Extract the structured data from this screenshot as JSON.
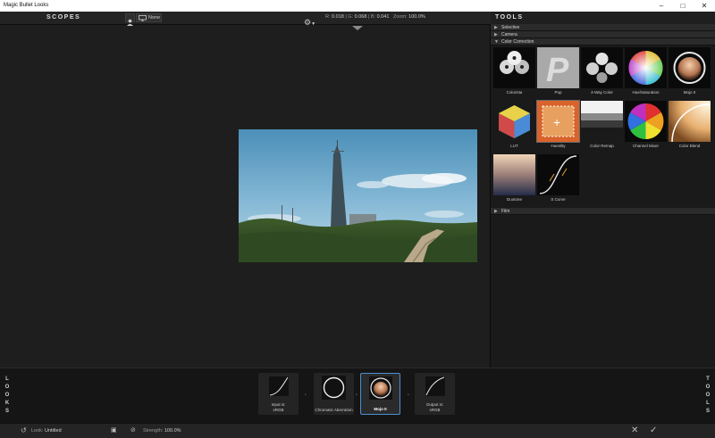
{
  "window": {
    "title": "Magic Bullet Looks"
  },
  "topbar": {
    "scopes_label": "SCOPES",
    "none_label": "None",
    "readout": {
      "r_label": "R:",
      "r": "0.018",
      "g_label": "G:",
      "g": "0.068",
      "b_label": "B:",
      "b": "0.041",
      "zoom_label": "Zoom:",
      "zoom": "100.0%"
    }
  },
  "tools": {
    "title": "TOOLS",
    "categories": [
      {
        "label": "Selective",
        "expanded": false
      },
      {
        "label": "Camera",
        "expanded": false
      },
      {
        "label": "Color Correction",
        "expanded": true
      },
      {
        "label": "Film",
        "expanded": false
      }
    ],
    "items": [
      {
        "label": "Colorista",
        "icon": "colorista-wheels-icon"
      },
      {
        "label": "Pop",
        "icon": "pop-p-icon"
      },
      {
        "label": "4-Way Color",
        "icon": "four-way-color-icon"
      },
      {
        "label": "Hue/Saturation",
        "icon": "hue-saturation-wheel-icon"
      },
      {
        "label": "Mojo II",
        "icon": "mojo-orb-icon"
      },
      {
        "label": "LUT",
        "icon": "lut-cube-icon"
      },
      {
        "label": "Hueslity",
        "icon": "hueslity-icon"
      },
      {
        "label": "Color Remap",
        "icon": "color-remap-icon"
      },
      {
        "label": "Channel Mixer",
        "icon": "channel-mixer-icon"
      },
      {
        "label": "Color Blend",
        "icon": "color-blend-icon"
      },
      {
        "label": "Duotone",
        "icon": "duotone-gradient-icon"
      },
      {
        "label": "S Curve",
        "icon": "s-curve-icon"
      }
    ]
  },
  "chain": {
    "left_label": [
      "L",
      "O",
      "O",
      "K",
      "S"
    ],
    "right_label": [
      "T",
      "O",
      "O",
      "L",
      "S"
    ],
    "nodes": [
      {
        "line1": "Input is:",
        "line2": "sRGB",
        "icon": "input-curve-icon"
      },
      {
        "line1": "Chromatic Aberration",
        "line2": "",
        "icon": "chromatic-ring-icon"
      },
      {
        "line1": "Mojo II",
        "line2": "",
        "icon": "mojo-orb-icon",
        "active": true
      },
      {
        "line1": "Output is:",
        "line2": "sRGB",
        "icon": "output-curve-icon"
      }
    ]
  },
  "status": {
    "look_label": "Look:",
    "look_name": "Untitled",
    "strength_label": "Strength:",
    "strength_value": "100.0%"
  },
  "colors": {
    "accent": "#4a8fd0",
    "background": "#1d1d1d"
  }
}
